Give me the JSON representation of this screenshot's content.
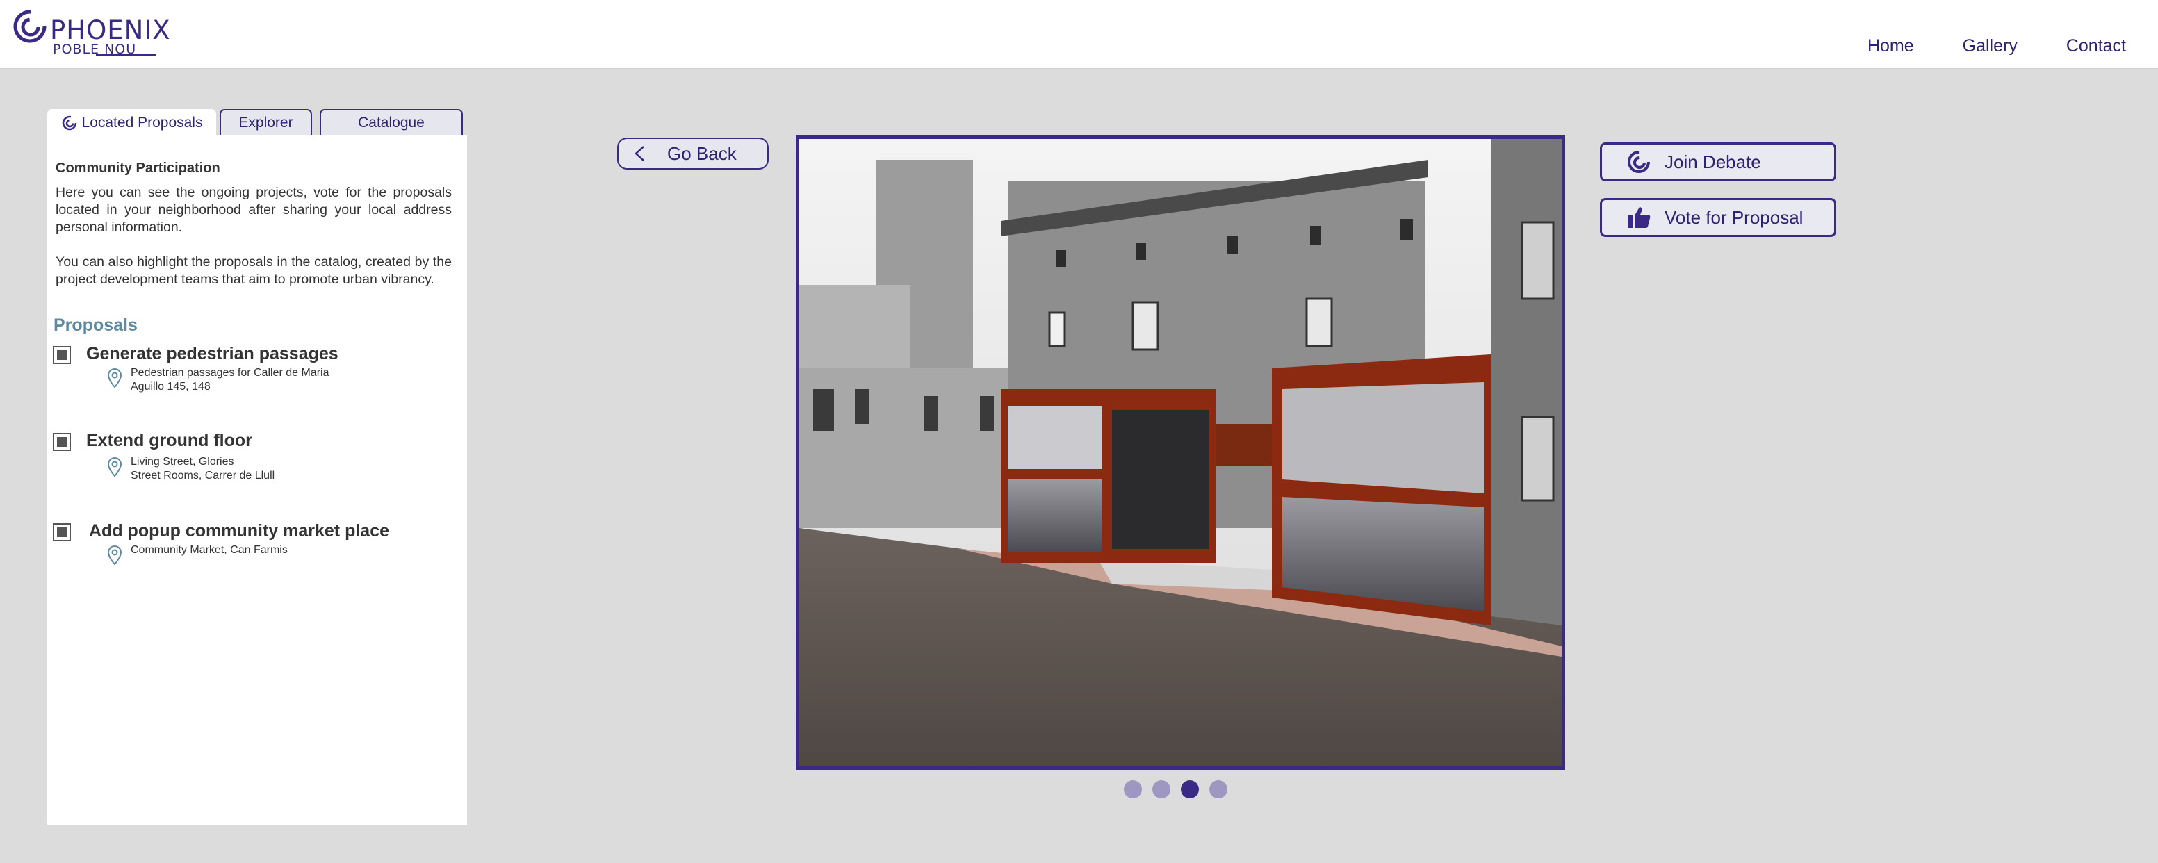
{
  "brand": {
    "title": "PHOENIX",
    "subtitle": "POBLE NOU"
  },
  "nav": {
    "home": "Home",
    "gallery": "Gallery",
    "contact": "Contact"
  },
  "tabs": {
    "located": "Located Proposals",
    "explorer": "Explorer",
    "catalogue": "Catalogue"
  },
  "panel": {
    "heading": "Community Participation",
    "paragraph1": "Here you can see the ongoing projects, vote for the proposals located in your neighborhood after sharing your local address personal information.",
    "paragraph2": "You can also highlight the proposals in the catalog, created by the project development teams that aim to promote urban vibrancy.",
    "proposals_title": "Proposals",
    "proposals": [
      {
        "title": "Generate pedestrian passages",
        "location_line1": "Pedestrian passages for Caller de Maria",
        "location_line2": "Aguillo 145, 148",
        "checked": true
      },
      {
        "title": "Extend ground floor",
        "location_line1": "Living Street, Glories",
        "location_line2": "Street Rooms, Carrer de Llull",
        "checked": true
      },
      {
        "title": "Add popup community market place",
        "location_line1": "Community Market, Can Farmis",
        "location_line2": "",
        "checked": true
      }
    ]
  },
  "go_back": "Go Back",
  "carousel": {
    "slide_count": 4,
    "active_slide": 3
  },
  "actions": {
    "join_debate": "Join Debate",
    "vote": "Vote for Proposal"
  },
  "colors": {
    "accent": "#3a2a86",
    "proposals_title": "#5d8aa0",
    "background": "#dcdcdc",
    "facade": "#a0381a"
  },
  "icons": {
    "logo": "swirl-logo-icon",
    "pin": "map-pin-icon",
    "back": "chevron-left-icon",
    "debate": "swirl-icon",
    "vote": "thumbs-up-icon"
  }
}
